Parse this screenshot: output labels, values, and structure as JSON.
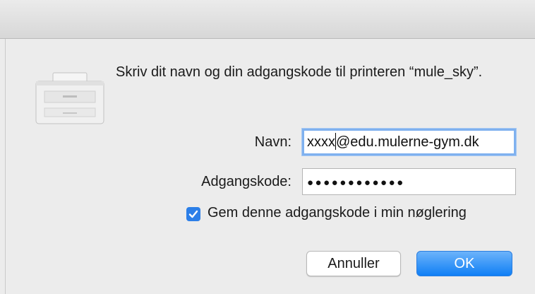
{
  "dialog": {
    "message": "Skriv dit navn og din adgangskode til printeren “mule_sky”."
  },
  "form": {
    "name_label": "Navn:",
    "name_value_before_caret": "xxxx",
    "name_value_after_caret": "@edu.mulerne-gym.dk",
    "password_label": "Adgangskode:",
    "password_mask": "●●●●●●●●●●●●",
    "remember_label": "Gem denne adgangskode i min nøglering",
    "remember_checked": true
  },
  "buttons": {
    "cancel_label": "Annuller",
    "ok_label": "OK"
  },
  "colors": {
    "accent": "#2c7fe8",
    "focus_ring": "#7fb1ef"
  },
  "icons": {
    "printer": "printer-icon",
    "check": "checkmark-icon"
  }
}
